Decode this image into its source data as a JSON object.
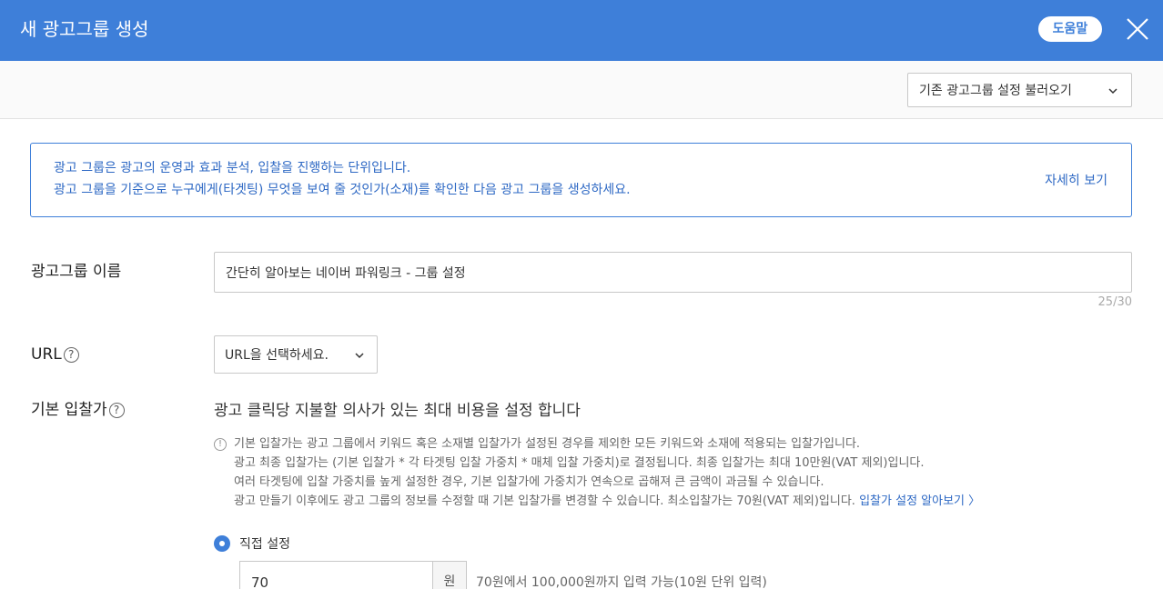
{
  "header": {
    "title": "새 광고그룹 생성",
    "help_label": "도움말",
    "bg_color": "#3e7fd9"
  },
  "toolbar": {
    "load_label": "기존 광고그룹 설정 불러오기"
  },
  "info": {
    "line1": "광고 그룹은 광고의 운영과 효과 분석, 입찰을 진행하는 단위입니다.",
    "line2": "광고 그룹을 기준으로 누구에게(타겟팅) 무엇을 보여 줄 것인가(소재)를 확인한 다음 광고 그룹을 생성하세요.",
    "more_label": "자세히 보기"
  },
  "group_name": {
    "label": "광고그룹 이름",
    "value": "간단히 알아보는 네이버 파워링크 - 그룹 설정",
    "counter": "25/30"
  },
  "url": {
    "label": "URL",
    "select_value": "URL을 선택하세요."
  },
  "bid": {
    "label": "기본 입찰가",
    "headline": "광고 클릭당 지불할 의사가 있는 최대 비용을 설정 합니다",
    "notice": [
      "기본 입찰가는 광고 그룹에서 키워드 혹은 소재별 입찰가가 설정된 경우를 제외한 모든 키워드와 소재에 적용되는 입찰가입니다.",
      "광고 최종 입찰가는 (기본 입찰가 * 각 타겟팅 입찰 가중치 * 매체 입찰 가중치)로 결정됩니다. 최종 입찰가는 최대 10만원(VAT 제외)입니다.",
      "여러 타겟팅에 입찰 가중치를 높게 설정한 경우, 기본 입찰가에 가중치가 연속으로 곱해져 큰 금액이 과금될 수 있습니다.",
      "광고 만들기 이후에도 광고 그룹의 정보를 수정할 때 기본 입찰가를 변경할 수 있습니다. 최소입찰가는 70원(VAT 제외)입니다."
    ],
    "notice_link": "입찰가 설정 알아보기 〉",
    "radio_label": "직접 설정",
    "value": "70",
    "unit": "원",
    "hint": "70원에서 100,000원까지 입력 가능(10원 단위 입력)"
  },
  "icons": {
    "close": "close-icon",
    "help": "question-circle-icon",
    "notice": "exclamation-circle-icon",
    "dropdown": "chevron-down-icon"
  }
}
